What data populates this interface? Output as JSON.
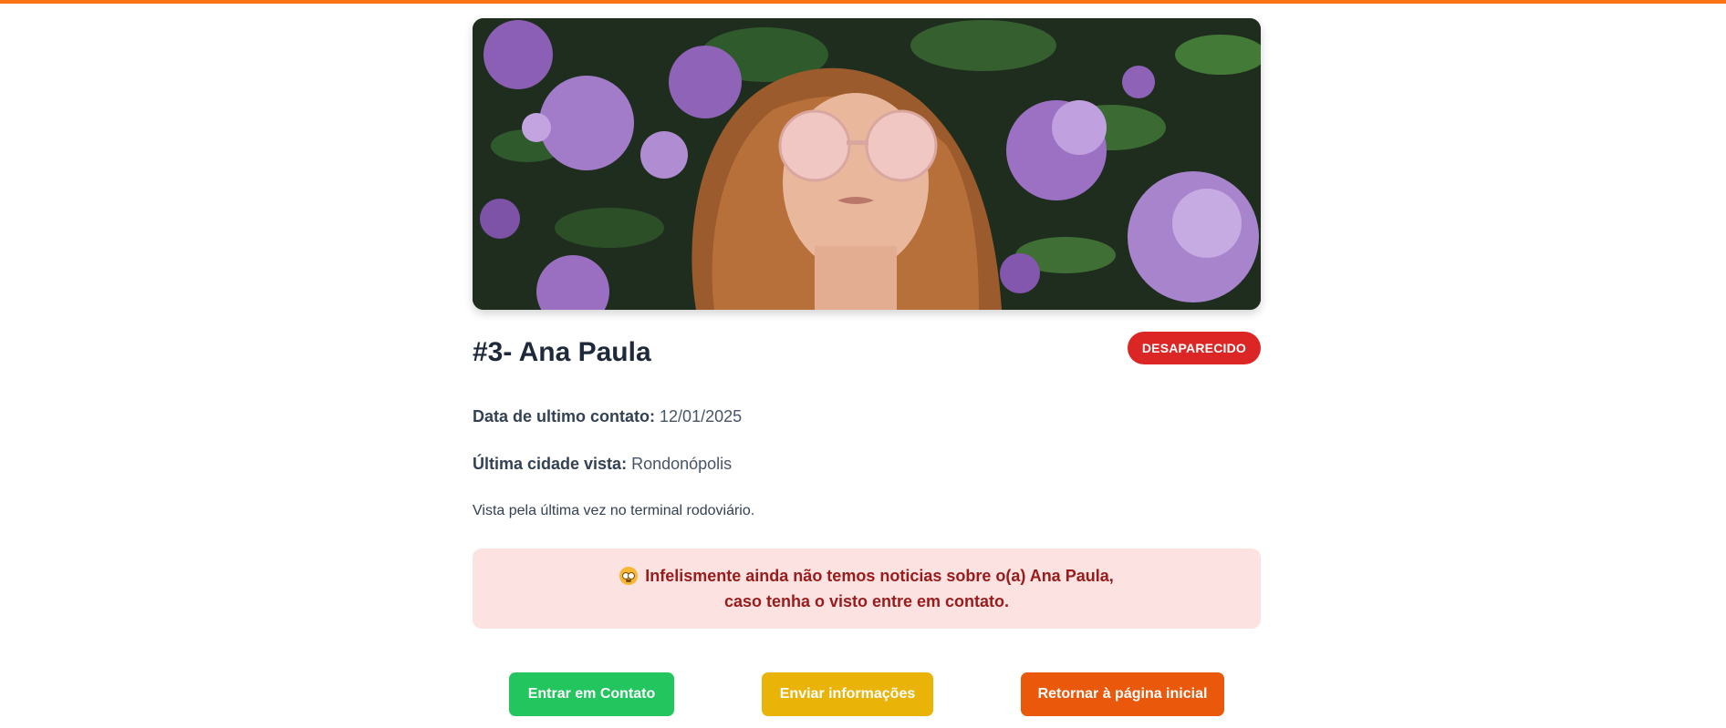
{
  "person": {
    "title": "#3- Ana Paula",
    "status": "DESAPARECIDO",
    "last_contact_label": "Data de ultimo contato:",
    "last_contact_value": "12/01/2025",
    "last_city_label": "Última cidade vista:",
    "last_city_value": "Rondonópolis",
    "description": "Vista pela última vez no terminal rodoviário."
  },
  "alert": {
    "icon": "worried-face-icon",
    "line1": "Infelismente ainda não temos noticias sobre o(a) Ana Paula,",
    "line2": "caso tenha o visto entre em contato."
  },
  "actions": {
    "contact": "Entrar em Contato",
    "send_info": "Enviar informações",
    "home": "Retornar à página inicial"
  },
  "colors": {
    "accent": "#f97316",
    "status_badge": "#dc2626",
    "alert_bg": "#fde2e2",
    "alert_text": "#991b1b",
    "contact_button": "#22c55e",
    "send_button": "#eab308",
    "home_button": "#ea580c"
  }
}
